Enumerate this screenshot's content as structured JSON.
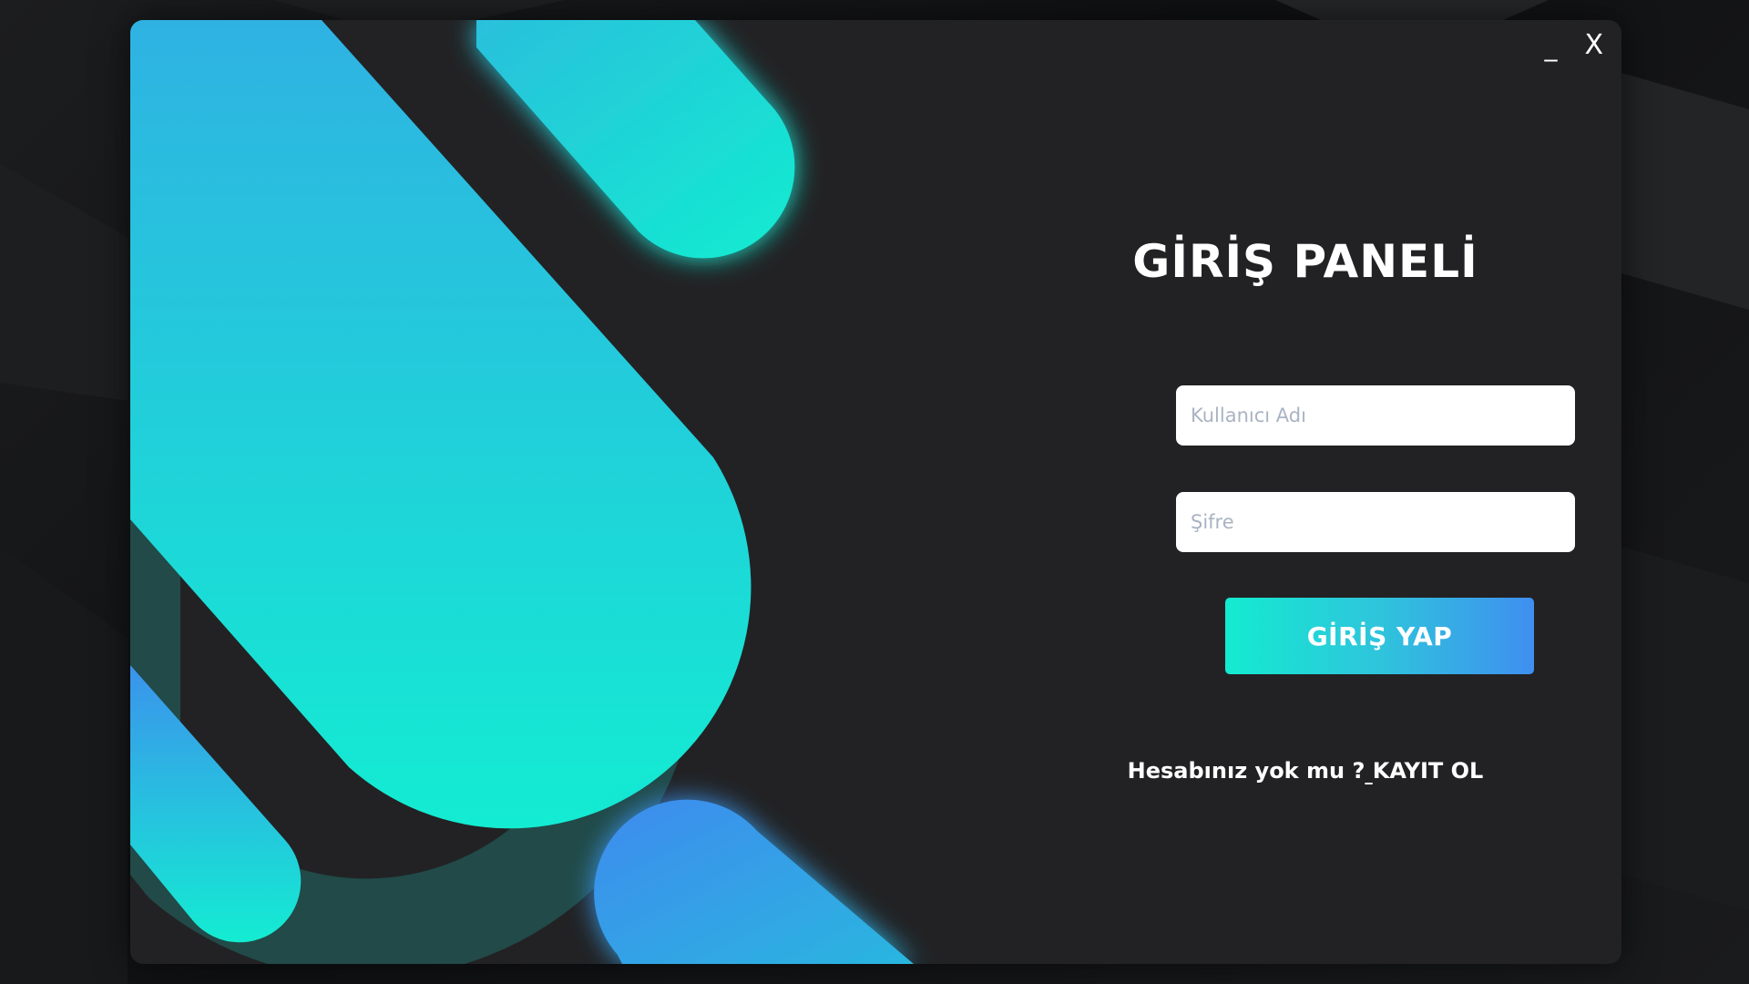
{
  "window": {
    "minimize_label": "_",
    "close_label": "X"
  },
  "form": {
    "title": "GİRİŞ PANELİ",
    "username_placeholder": "Kullanıcı Adı",
    "username_value": "",
    "password_placeholder": "Şifre",
    "password_value": "",
    "login_button_label": "GİRİŞ YAP",
    "register_text": "Hesabınız yok mu ?",
    "register_link_label": "KAYIT OL"
  },
  "colors": {
    "window_background": "#222224",
    "accent_teal": "#14ebd0",
    "accent_blue": "#3f8ff0",
    "ring_dark_teal": "#214a48",
    "text": "#ffffff",
    "placeholder": "#a9b3c3"
  },
  "icons": {
    "minimize": "minimize-icon",
    "close": "close-icon"
  }
}
